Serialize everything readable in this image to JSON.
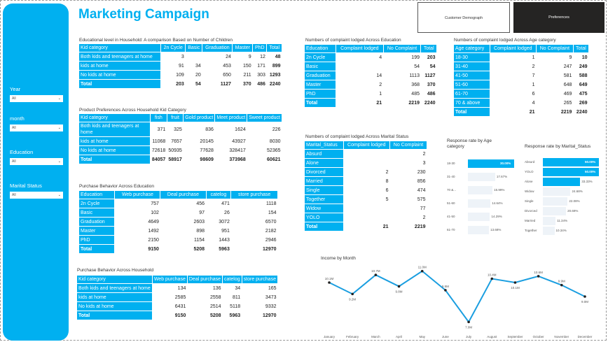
{
  "title": "Marketing Campaign",
  "nav": {
    "customer": "Customer Demograph",
    "preferences": "Preferences"
  },
  "slicers": [
    {
      "label": "Year",
      "value": "All"
    },
    {
      "label": "month",
      "value": "All"
    },
    {
      "label": "Education",
      "value": "All"
    },
    {
      "label": "Marital Status",
      "value": "All"
    }
  ],
  "tables": {
    "edu_children": {
      "caption": "Educational level in Household: A comparison Based on Number of Children",
      "headers": [
        "Kid category",
        "2n Cycle",
        "Basic",
        "Graduation",
        "Master",
        "PhD",
        "Total"
      ],
      "rows": [
        [
          "Both kids and teenagers at home",
          "3",
          "",
          "24",
          "9",
          "12",
          "48"
        ],
        [
          "kids at home",
          "91",
          "34",
          "453",
          "150",
          "171",
          "899"
        ],
        [
          "No kids at home",
          "109",
          "20",
          "650",
          "211",
          "303",
          "1293"
        ],
        [
          "Total",
          "203",
          "54",
          "1127",
          "370",
          "486",
          "2240"
        ]
      ]
    },
    "product_pref": {
      "caption": "Product Preferences Across Household Kid Category",
      "headers": [
        "Kid category",
        "fish",
        "fruit",
        "Gold product",
        "Meet product",
        "Sweet product"
      ],
      "rows": [
        [
          "Both kids and teenagers at home",
          "371",
          "325",
          "836",
          "1624",
          "226"
        ],
        [
          "kids at home",
          "11068",
          "7657",
          "20145",
          "43927",
          "8030"
        ],
        [
          "No kids at home",
          "72618",
          "50935",
          "77628",
          "328417",
          "52365"
        ],
        [
          "Total",
          "84057",
          "58917",
          "98609",
          "373968",
          "60621"
        ]
      ]
    },
    "purchase_edu": {
      "caption": "Purchase Behavior Across Education",
      "headers": [
        "Education",
        "Web purchase",
        "Deal purchase",
        "catelog",
        "store purchase"
      ],
      "rows": [
        [
          "2n Cycle",
          "757",
          "456",
          "471",
          "1118"
        ],
        [
          "Basic",
          "102",
          "97",
          "26",
          "154"
        ],
        [
          "Graduation",
          "4649",
          "2603",
          "3072",
          "6570"
        ],
        [
          "Master",
          "1492",
          "898",
          "951",
          "2182"
        ],
        [
          "PhD",
          "2150",
          "1154",
          "1443",
          "2946"
        ],
        [
          "Total",
          "9150",
          "5208",
          "5963",
          "12970"
        ]
      ]
    },
    "purchase_household": {
      "caption": "Purchase Behavior Across Household",
      "headers": [
        "Kid category",
        "Web purchase",
        "Deal purchase",
        "catelog",
        "store purchase"
      ],
      "rows": [
        [
          "Both kids and teenagers at home",
          "134",
          "136",
          "34",
          "165"
        ],
        [
          "kids at home",
          "2585",
          "2558",
          "811",
          "3473"
        ],
        [
          "No kids at home",
          "6431",
          "2514",
          "5118",
          "9332"
        ],
        [
          "Total",
          "9150",
          "5208",
          "5963",
          "12970"
        ]
      ]
    },
    "complaint_edu": {
      "caption": "Numbers of complaint lodged Across Education",
      "headers": [
        "Education",
        "Complaint lodged",
        "No Complaint",
        "Total"
      ],
      "rows": [
        [
          "2n Cycle",
          "4",
          "199",
          "203"
        ],
        [
          "Basic",
          "",
          "54",
          "54"
        ],
        [
          "Graduation",
          "14",
          "1113",
          "1127"
        ],
        [
          "Master",
          "2",
          "368",
          "370"
        ],
        [
          "PhD",
          "1",
          "485",
          "486"
        ],
        [
          "Total",
          "21",
          "2219",
          "2240"
        ]
      ]
    },
    "complaint_age": {
      "caption": "Numbers of complaint lodged Across Age category",
      "headers": [
        "Age category",
        "Complaint lodged",
        "No Complaint",
        "Total"
      ],
      "rows": [
        [
          "18-30",
          "1",
          "9",
          "10"
        ],
        [
          "31-40",
          "2",
          "247",
          "249"
        ],
        [
          "41-50",
          "7",
          "581",
          "588"
        ],
        [
          "51-60",
          "1",
          "648",
          "649"
        ],
        [
          "61-70",
          "6",
          "469",
          "475"
        ],
        [
          "70 & above",
          "4",
          "265",
          "269"
        ],
        [
          "Total",
          "21",
          "2219",
          "2240"
        ]
      ]
    },
    "complaint_marital": {
      "caption": "Numbers of complaint lodged Across Marital Status",
      "headers": [
        "Marital_Status",
        "Complaint lodged",
        "No Complaint"
      ],
      "rows": [
        [
          "Absurd",
          "",
          "2"
        ],
        [
          "Alone",
          "",
          "3"
        ],
        [
          "Divorced",
          "2",
          "230"
        ],
        [
          "Married",
          "8",
          "856"
        ],
        [
          "Single",
          "6",
          "474"
        ],
        [
          "Together",
          "5",
          "575"
        ],
        [
          "Widow",
          "",
          "77"
        ],
        [
          "YOLO",
          "",
          "2"
        ],
        [
          "Total",
          "21",
          "2219"
        ]
      ]
    }
  },
  "chart_data": [
    {
      "type": "bar",
      "orientation": "horizontal",
      "title": "Response rate by Age category",
      "categories": [
        "18-30",
        "31-40",
        "70 &...",
        "51-60",
        "41-50",
        "61-70"
      ],
      "values": [
        30.0,
        17.67,
        15.99,
        14.64,
        14.29,
        13.68
      ],
      "value_labels": [
        "30.00%",
        "17.67%",
        "15.99%",
        "14.64%",
        "14.29%",
        "13.68%"
      ],
      "xlim": [
        0,
        30
      ]
    },
    {
      "type": "bar",
      "orientation": "horizontal",
      "title": "Response rate by Marital_Status",
      "categories": [
        "Absurd",
        "YOLO",
        "Alone",
        "Widow",
        "Single",
        "Divorced",
        "Married",
        "Together"
      ],
      "values": [
        50.0,
        50.0,
        33.33,
        24.68,
        22.08,
        20.69,
        11.34,
        10.34
      ],
      "value_labels": [
        "50.00%",
        "50.00%",
        "33.33%",
        "24.68%",
        "22.08%",
        "20.69%",
        "11.34%",
        "10.34%"
      ],
      "xlim": [
        0,
        50
      ]
    },
    {
      "type": "line",
      "title": "Income by Month",
      "x": [
        "January",
        "February",
        "March",
        "April",
        "May",
        "June",
        "July",
        "August",
        "September",
        "October",
        "November",
        "December"
      ],
      "values": [
        10.1,
        9.2,
        10.7,
        9.8,
        11.0,
        9.5,
        7.0,
        10.4,
        10.1,
        10.6,
        9.9,
        9.0
      ],
      "value_labels": [
        "10.1M",
        "9.2M",
        "10.7M",
        "9.8M",
        "11.0M",
        "9.5M",
        "7.0M",
        "10.4M",
        "10.1M",
        "10.6M",
        "9.9M",
        "9.0M"
      ],
      "ylim": [
        6.8,
        11.2
      ]
    }
  ]
}
